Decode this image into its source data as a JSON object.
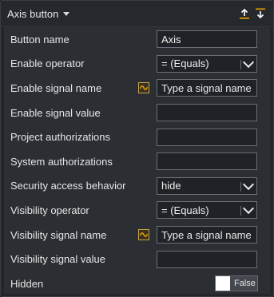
{
  "header": {
    "title": "Axis button",
    "tools": [
      "upload-icon",
      "download-icon"
    ]
  },
  "rows": {
    "button_name": {
      "label": "Button name",
      "value": "Axis"
    },
    "enable_operator": {
      "label": "Enable operator",
      "value": "= (Equals)"
    },
    "enable_signal_name": {
      "label": "Enable signal name",
      "placeholder": "Type a signal name"
    },
    "enable_signal_value": {
      "label": "Enable signal value",
      "value": ""
    },
    "project_auth": {
      "label": "Project authorizations",
      "value": ""
    },
    "system_auth": {
      "label": "System authorizations",
      "value": ""
    },
    "security_access": {
      "label": "Security access behavior",
      "value": "hide"
    },
    "visibility_operator": {
      "label": "Visibility operator",
      "value": "= (Equals)"
    },
    "visibility_signal_name": {
      "label": "Visibility signal name",
      "placeholder": "Type a signal name"
    },
    "visibility_signal_value": {
      "label": "Visibility signal value",
      "value": ""
    },
    "hidden": {
      "label": "Hidden",
      "value": "False"
    }
  },
  "colors": {
    "accent": "#f0a500",
    "panel_bg": "#2b2e33"
  }
}
